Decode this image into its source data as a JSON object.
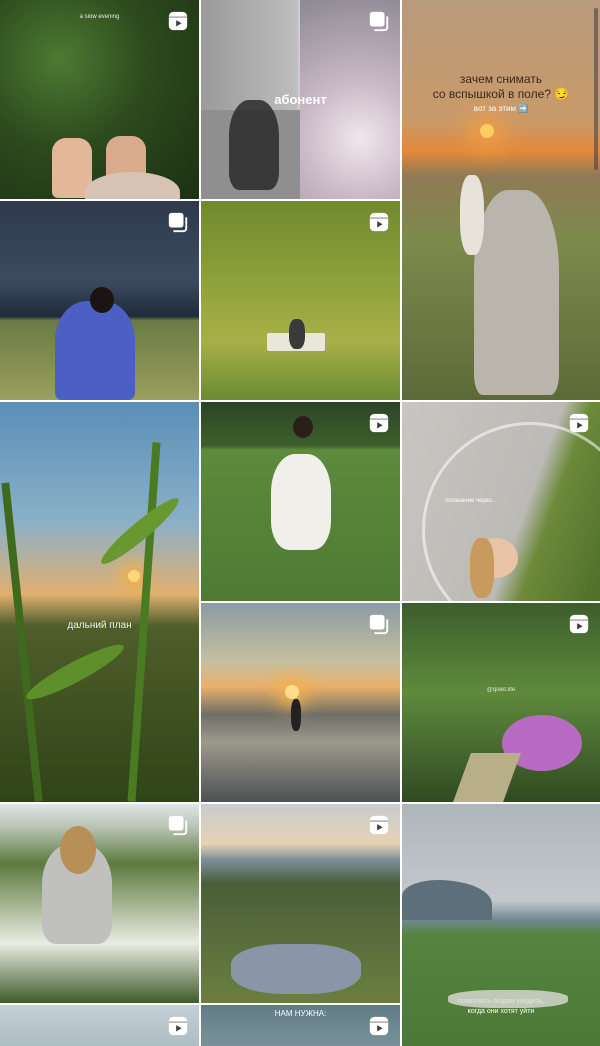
{
  "grid": {
    "tiles": [
      {
        "id": "t1",
        "badge": "reels-icon",
        "caption": "a slow evening"
      },
      {
        "id": "t2",
        "badge": "multiple-posts-icon",
        "caption": "абонент"
      },
      {
        "id": "t3",
        "badge": "",
        "caption_line1": "зачем снимать",
        "caption_line2": "со вспышкой в поле? 😏",
        "caption_sub": "вот за этим ➡️"
      },
      {
        "id": "t4",
        "badge": "multiple-posts-icon"
      },
      {
        "id": "t5",
        "badge": "reels-icon"
      },
      {
        "id": "t6",
        "badge": "",
        "caption": "дальний план"
      },
      {
        "id": "t7",
        "badge": "reels-icon"
      },
      {
        "id": "t8",
        "badge": "reels-icon",
        "caption": "осознание через..."
      },
      {
        "id": "t9",
        "badge": "multiple-posts-icon"
      },
      {
        "id": "t10",
        "badge": "reels-icon",
        "caption": "@quiet.life"
      },
      {
        "id": "t11",
        "badge": "multiple-posts-icon"
      },
      {
        "id": "t12",
        "badge": "reels-icon"
      },
      {
        "id": "t13",
        "badge": "",
        "caption_line1": "позволить людям уходить,",
        "caption_line2": "когда они хотят уйти"
      },
      {
        "id": "t14",
        "badge": "reels-icon"
      },
      {
        "id": "t15",
        "badge": "reels-icon",
        "caption": "НАМ НУЖНА:"
      },
      {
        "id": "t16",
        "badge": ""
      }
    ]
  },
  "colors": {
    "badge": "#ffffff",
    "background": "#ffffff"
  }
}
